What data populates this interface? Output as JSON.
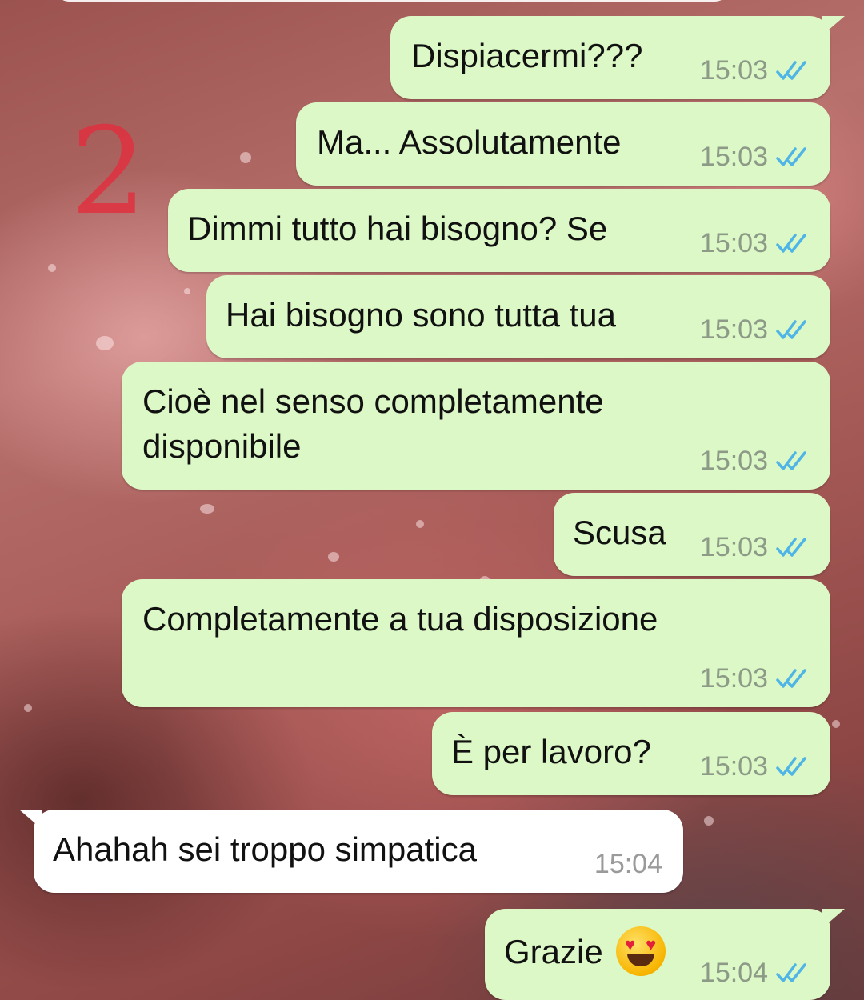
{
  "overlay": {
    "page_number": "2"
  },
  "theme": {
    "outgoing_bubble": "#dcf8c6",
    "incoming_bubble": "#ffffff",
    "read_ticks": "#4fb5e6",
    "annotation": "#e0313f"
  },
  "messages": [
    {
      "direction": "outgoing",
      "text": "Dispiacermi???",
      "time": "15:03",
      "status": "read"
    },
    {
      "direction": "outgoing",
      "text": "Ma... Assolutamente",
      "time": "15:03",
      "status": "read"
    },
    {
      "direction": "outgoing",
      "text": "Dimmi tutto hai bisogno? Se",
      "time": "15:03",
      "status": "read"
    },
    {
      "direction": "outgoing",
      "text": "Hai bisogno sono tutta tua",
      "time": "15:03",
      "status": "read"
    },
    {
      "direction": "outgoing",
      "text_line1": "Cioè nel senso completamente",
      "text_line2": "disponibile",
      "time": "15:03",
      "status": "read"
    },
    {
      "direction": "outgoing",
      "text": "Scusa",
      "time": "15:03",
      "status": "read"
    },
    {
      "direction": "outgoing",
      "text": "Completamente a tua disposizione",
      "time": "15:03",
      "status": "read"
    },
    {
      "direction": "outgoing",
      "text": "È per lavoro?",
      "time": "15:03",
      "status": "read"
    },
    {
      "direction": "incoming",
      "text": "Ahahah sei troppo simpatica",
      "time": "15:04"
    },
    {
      "direction": "outgoing",
      "text": "Grazie",
      "emoji": "smiling-face-with-heart-eyes-emoji",
      "time": "15:04",
      "status": "read"
    }
  ]
}
